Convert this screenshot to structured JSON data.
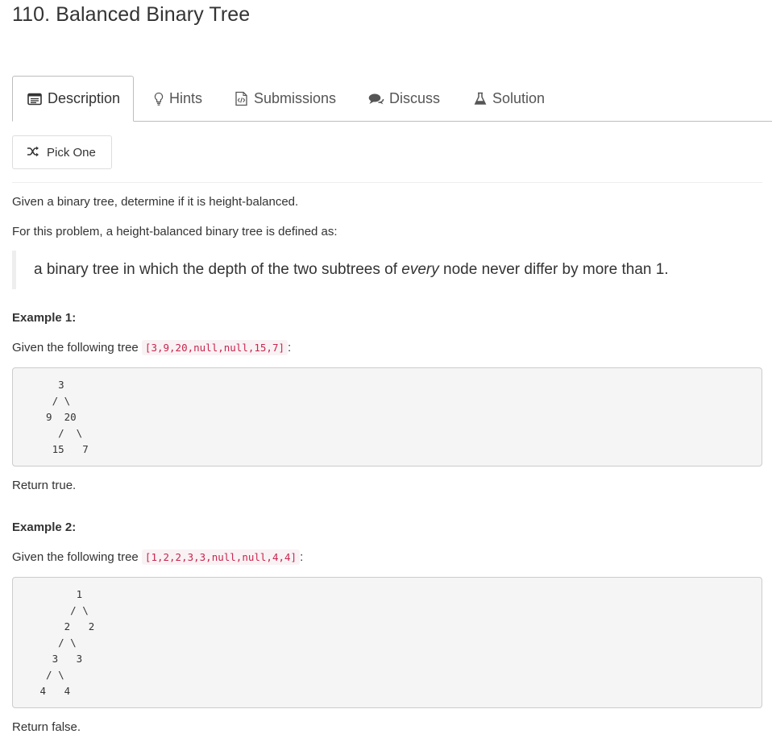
{
  "problem": {
    "title": "110. Balanced Binary Tree"
  },
  "tabs": [
    {
      "label": "Description",
      "icon": "description-icon"
    },
    {
      "label": "Hints",
      "icon": "lightbulb-icon"
    },
    {
      "label": "Submissions",
      "icon": "code-file-icon"
    },
    {
      "label": "Discuss",
      "icon": "chat-icon"
    },
    {
      "label": "Solution",
      "icon": "flask-icon"
    }
  ],
  "pick_one": {
    "label": "Pick One",
    "icon": "shuffle-icon"
  },
  "content": {
    "intro": "Given a binary tree, determine if it is height-balanced.",
    "definition_intro": "For this problem, a height-balanced binary tree is defined as:",
    "quote": {
      "before": "a binary tree in which the depth of the two subtrees of ",
      "emphasis": "every",
      "after": " node never differ by more than 1."
    },
    "examples": [
      {
        "heading": "Example 1:",
        "given_text": "Given the following tree ",
        "tree_literal": "[3,9,20,null,null,15,7]",
        "colon": ":",
        "tree_diagram": "    3\n   / \\\n  9  20\n    /  \\\n   15   7",
        "result": "Return true."
      },
      {
        "heading": "Example 2:",
        "given_text": "Given the following tree ",
        "tree_literal": "[1,2,2,3,3,null,null,4,4]",
        "colon": ":",
        "tree_diagram": "       1\n      / \\\n     2   2\n    / \\\n   3   3\n  / \\\n 4   4",
        "result": "Return false."
      }
    ]
  }
}
